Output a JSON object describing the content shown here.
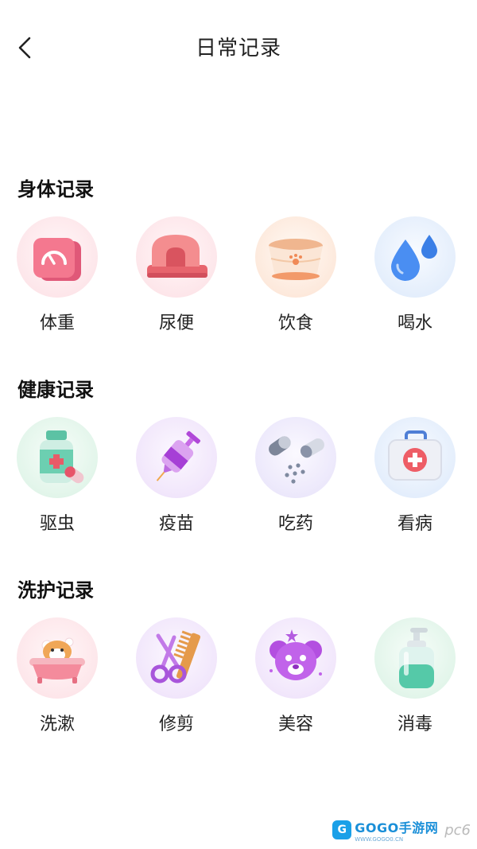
{
  "header": {
    "title": "日常记录"
  },
  "sections": [
    {
      "title": "身体记录",
      "items": [
        {
          "label": "体重",
          "icon": "scale-icon"
        },
        {
          "label": "尿便",
          "icon": "litter-box-icon"
        },
        {
          "label": "饮食",
          "icon": "food-bowl-icon"
        },
        {
          "label": "喝水",
          "icon": "water-drops-icon"
        }
      ]
    },
    {
      "title": "健康记录",
      "items": [
        {
          "label": "驱虫",
          "icon": "deworm-medicine-icon"
        },
        {
          "label": "疫苗",
          "icon": "vaccine-syringe-icon"
        },
        {
          "label": "吃药",
          "icon": "pills-icon"
        },
        {
          "label": "看病",
          "icon": "first-aid-kit-icon"
        }
      ]
    },
    {
      "title": "洗护记录",
      "items": [
        {
          "label": "洗漱",
          "icon": "bathtub-icon"
        },
        {
          "label": "修剪",
          "icon": "scissors-comb-icon"
        },
        {
          "label": "美容",
          "icon": "beauty-dog-icon"
        },
        {
          "label": "消毒",
          "icon": "disinfectant-bottle-icon"
        }
      ]
    }
  ],
  "watermark": {
    "brand": "GOGO手游网",
    "url": "WWW.GOGO0.CN",
    "site": "pc6"
  }
}
